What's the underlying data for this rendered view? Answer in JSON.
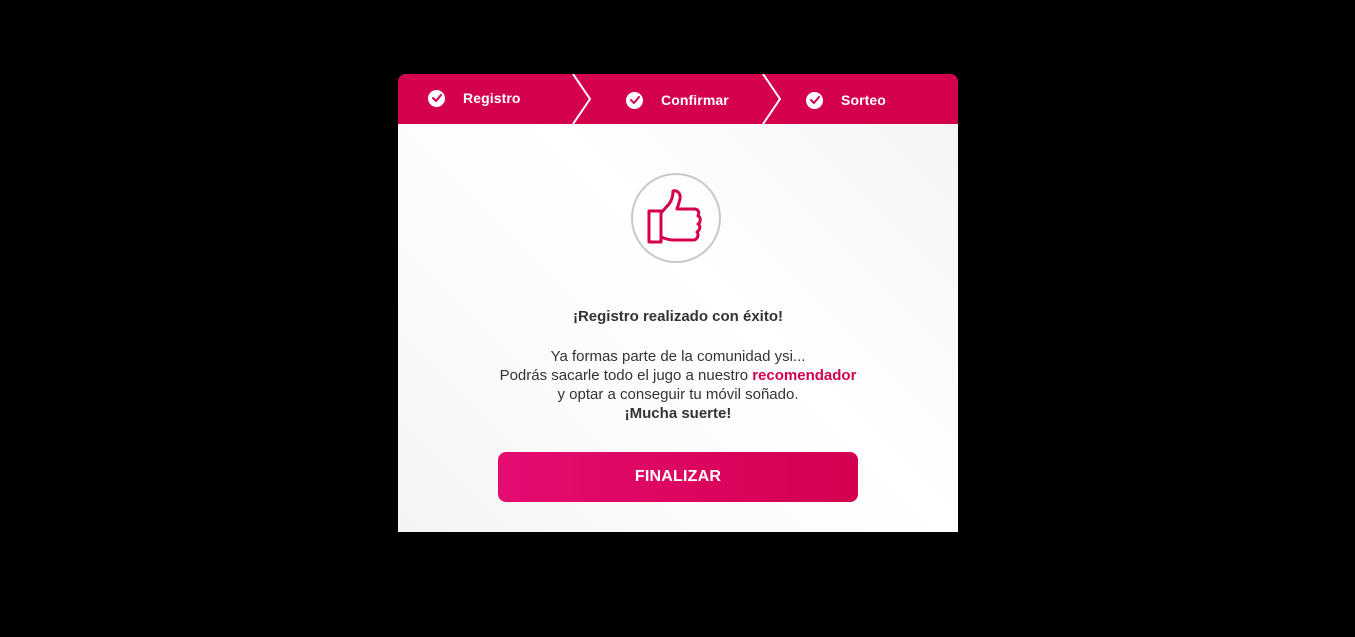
{
  "steps": [
    {
      "label": "Registro",
      "status": "completed",
      "icon": "check-circle-icon"
    },
    {
      "label": "Confirmar",
      "status": "completed",
      "icon": "check-circle-icon"
    },
    {
      "label": "Sorteo",
      "status": "completed",
      "icon": "check-circle-icon"
    }
  ],
  "success": {
    "icon": "thumbs-up-icon",
    "title": "¡Registro realizado con éxito!",
    "line1": "Ya formas parte de la comunidad ysi...",
    "line2_prefix": "Podrás sacarle todo el jugo a nuestro ",
    "line2_link": "recomendador",
    "line3": "y optar a conseguir tu móvil soñado.",
    "line4": "¡Mucha suerte!"
  },
  "finish_button": {
    "label": "FINALIZAR"
  },
  "colors": {
    "accent": "#d4004e",
    "button_gradient_start": "#e50c70",
    "button_gradient_end": "#d40050",
    "text": "#333333",
    "icon_border": "#c9c9c9",
    "background": "#000000"
  }
}
